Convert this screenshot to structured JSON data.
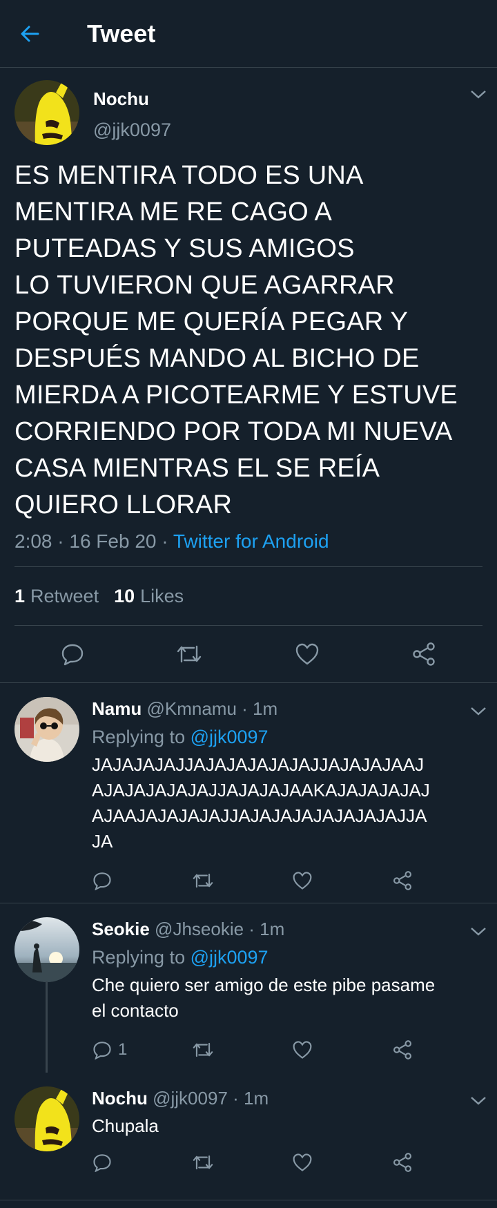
{
  "header": {
    "title": "Tweet"
  },
  "main_tweet": {
    "display_name": "Nochu",
    "handle": "@jjk0097",
    "text_lines": [
      "ES MENTIRA TODO ES UNA",
      "MENTIRA ME RE CAGO A",
      "PUTEADAS Y SUS AMIGOS",
      "LO TUVIERON QUE AGARRAR",
      "PORQUE ME QUERÍA PEGAR Y",
      "DESPUÉS MANDO AL BICHO DE",
      "MIERDA A PICOTEARME Y ESTUVE",
      "CORRIENDO POR TODA MI NUEVA",
      "CASA MIENTRAS EL SE REÍA",
      "QUIERO LLORAR"
    ],
    "time": "2:08 · 16 Feb 20 · ",
    "source": "Twitter for Android",
    "retweets_count": "1",
    "retweets_label": "Retweet",
    "likes_count": "10",
    "likes_label": "Likes"
  },
  "replies": [
    {
      "display_name": "Namu",
      "handle_time": " @Kmnamu · 1m",
      "replying_prefix": "Replying to ",
      "replying_handle": "@jjk0097",
      "text_lines": [
        "JAJAJAJAJJAJAJAJAJAJAJJAJAJAJAAJ",
        "AJAJAJAJAJAJJAJAJAJAAKAJAJAJAJAJ",
        "AJAAJAJAJAJAJJAJAJAJAJAJAJAJAJJA",
        "JA"
      ],
      "reply_count": ""
    },
    {
      "display_name": "Seokie",
      "handle_time": " @Jhseokie · 1m",
      "replying_prefix": "Replying to ",
      "replying_handle": "@jjk0097",
      "text_lines": [
        "Che quiero ser amigo de este pibe pasame",
        "el contacto"
      ],
      "reply_count": "1"
    },
    {
      "display_name": "Nochu",
      "handle_time": " @jjk0097 · 1m",
      "text_lines": [
        "Chupala"
      ],
      "reply_count": ""
    }
  ],
  "colors": {
    "background": "#15202b",
    "accent": "#1da1f2",
    "secondary_text": "#8899a6",
    "divider": "#38444d"
  },
  "icons": [
    "back-arrow-icon",
    "chevron-down-icon",
    "reply-icon",
    "retweet-icon",
    "like-icon",
    "share-icon"
  ]
}
